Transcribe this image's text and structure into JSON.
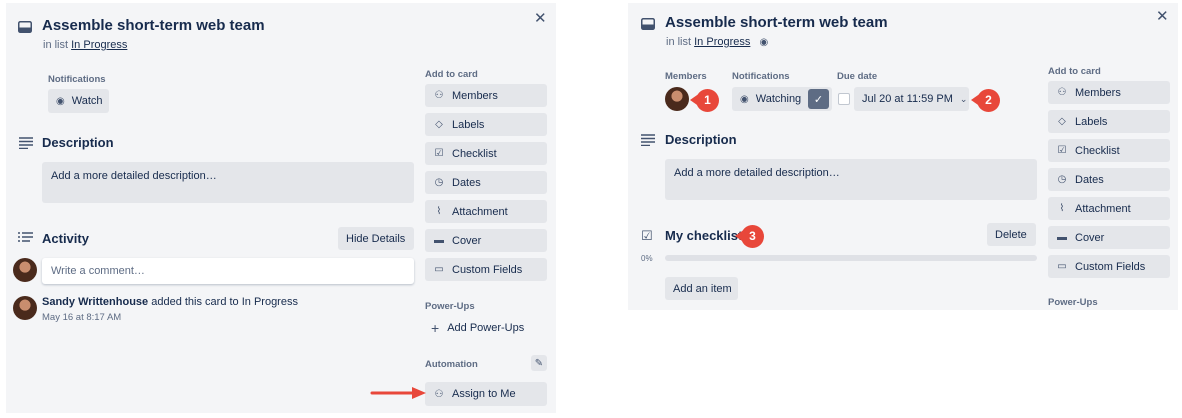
{
  "left": {
    "card_title": "Assemble short-term web team",
    "in_list_prefix": "in list",
    "list_name": "In Progress",
    "notifications_label": "Notifications",
    "watch_label": "Watch",
    "description_title": "Description",
    "description_placeholder": "Add a more detailed description…",
    "activity_title": "Activity",
    "hide_details": "Hide Details",
    "comment_placeholder": "Write a comment…",
    "activity_user": "Sandy Writtenhouse",
    "activity_text": "added this card to In Progress",
    "activity_time": "May 16 at 8:17 AM",
    "add_to_card": "Add to card",
    "side_buttons": [
      "Members",
      "Labels",
      "Checklist",
      "Dates",
      "Attachment",
      "Cover",
      "Custom Fields"
    ],
    "power_ups_title": "Power-Ups",
    "add_power_ups": "Add Power-Ups",
    "automation_title": "Automation",
    "assign_to_me": "Assign to Me"
  },
  "right": {
    "card_title": "Assemble short-term web team",
    "in_list_prefix": "in list",
    "list_name": "In Progress",
    "members_label": "Members",
    "notifications_label": "Notifications",
    "due_date_label": "Due date",
    "watching_label": "Watching",
    "due_date_value": "Jul 20 at 11:59 PM",
    "description_title": "Description",
    "description_placeholder": "Add a more detailed description…",
    "checklist_title": "My checklist",
    "delete_label": "Delete",
    "progress_text": "0%",
    "progress_fraction": 0,
    "add_item": "Add an item",
    "add_to_card": "Add to card",
    "side_buttons": [
      "Members",
      "Labels",
      "Checklist",
      "Dates",
      "Attachment",
      "Cover",
      "Custom Fields"
    ],
    "power_ups_title": "Power-Ups"
  },
  "callouts": [
    "1",
    "2",
    "3"
  ],
  "colors": {
    "callout": "#e8473a",
    "panel": "#f4f5f7",
    "button": "#e4e6ea",
    "checked": "#5e6c84"
  },
  "icons": {
    "side_buttons": [
      "person-icon",
      "tag-icon",
      "checklist-icon",
      "clock-icon",
      "paperclip-icon",
      "cover-icon",
      "custom-fields-icon"
    ]
  }
}
